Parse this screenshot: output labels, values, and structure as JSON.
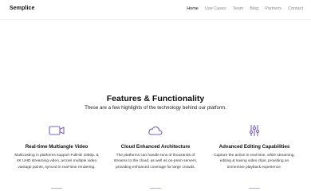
{
  "header": {
    "logo": "Semplice",
    "nav": [
      {
        "label": "Home",
        "active": true
      },
      {
        "label": "Use Cases",
        "active": false
      },
      {
        "label": "Team",
        "active": false
      },
      {
        "label": "Blog",
        "active": false
      },
      {
        "label": "Partners",
        "active": false
      },
      {
        "label": "Contact",
        "active": false
      }
    ]
  },
  "features_section": {
    "title": "Features & Functionality",
    "subtitle": "These are a few highlights of the technology behind our platform.",
    "items": [
      {
        "icon": "video-camera-icon",
        "title": "Real-time Multiangle Video",
        "description": "Multicasting in platforms support FullHD 1080p, & 4K UHD streaming video, across multiple video vantage points, synced in real-time rendering."
      },
      {
        "icon": "cloud-icon",
        "title": "Cloud Enhanced Architecture",
        "description": "The platforms can handle tens of thousands of streams to the cloud, as well as on-prem servers, providing enhanced coverage for large crowds."
      },
      {
        "icon": "sliders-icon",
        "title": "Advanced Editing Capabilities",
        "description": "Capture the action in real-time, while streaming, editing & saving video clips, providing an immersive playback experience."
      }
    ]
  },
  "colors": {
    "accent": "#7b5fd6",
    "text": "#111111",
    "muted": "#8a8a8a"
  }
}
